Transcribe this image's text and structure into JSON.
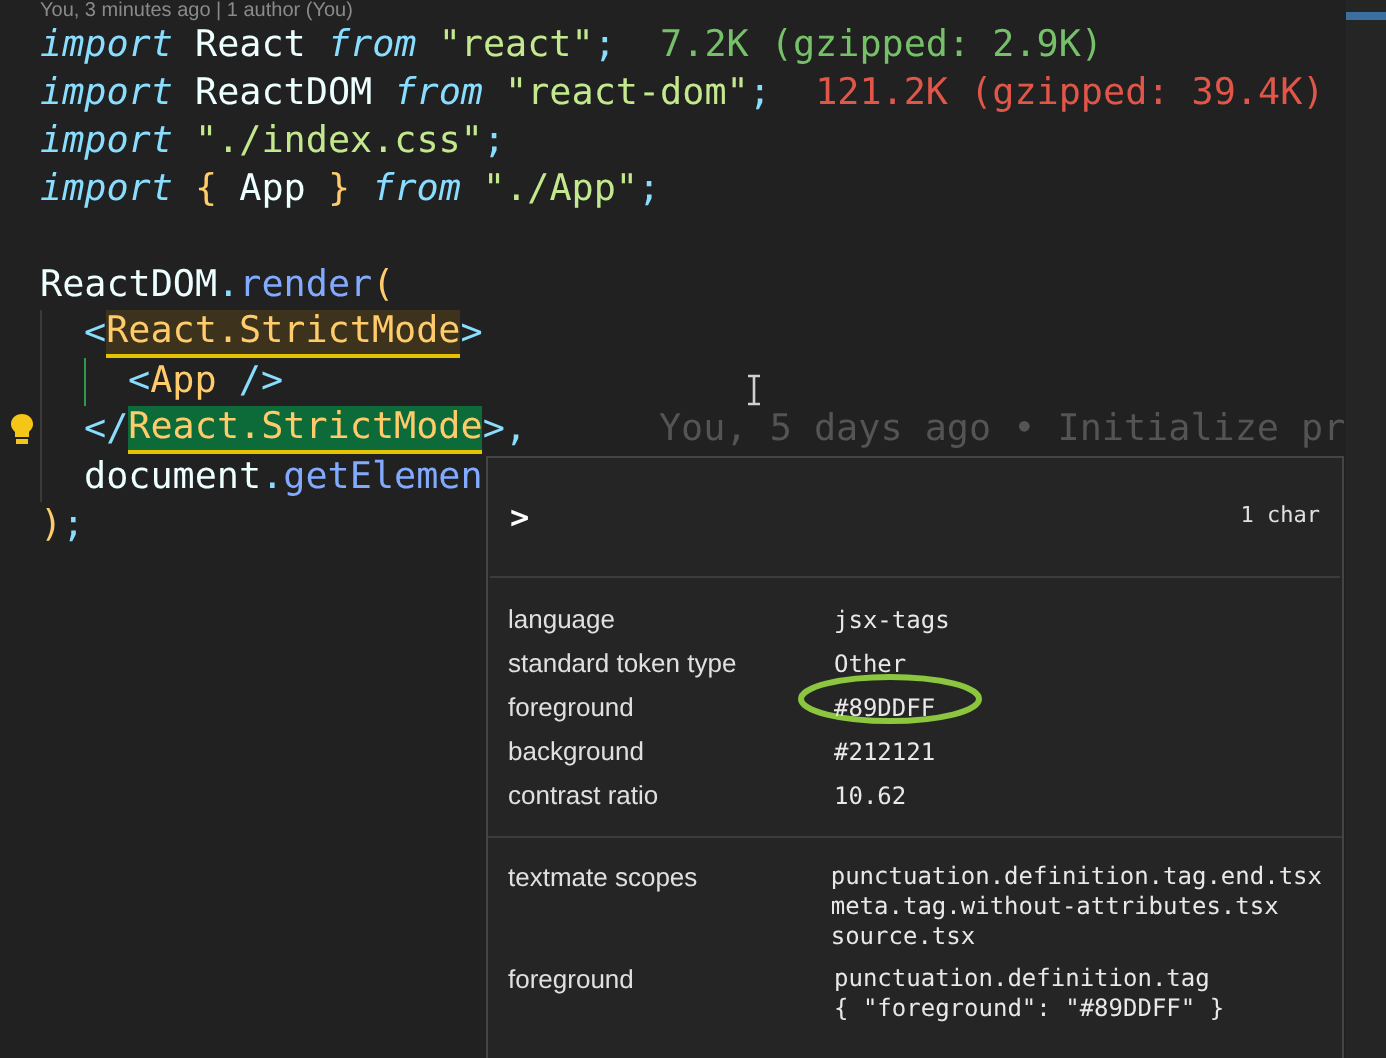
{
  "blame_header": "You, 3 minutes ago | 1 author (You)",
  "code_lines": [
    {
      "kind": "code",
      "tokens": [
        {
          "text": "import",
          "kind": "keyword"
        },
        {
          "text": " React ",
          "kind": "ident"
        },
        {
          "text": "from",
          "kind": "keyword"
        },
        {
          "text": " \"react\"",
          "kind": "string"
        },
        {
          "text": ";",
          "kind": "punct"
        },
        {
          "text": "  7.2K (gzipped: 2.9K)",
          "kind": "size-ok"
        }
      ]
    },
    {
      "kind": "code",
      "tokens": [
        {
          "text": "import",
          "kind": "keyword"
        },
        {
          "text": " ReactDOM ",
          "kind": "ident"
        },
        {
          "text": "from",
          "kind": "keyword"
        },
        {
          "text": " \"react-dom\"",
          "kind": "string"
        },
        {
          "text": ";",
          "kind": "punct"
        },
        {
          "text": "  121.2K (gzipped: 39.4K)",
          "kind": "size-bad"
        }
      ]
    },
    {
      "kind": "code",
      "tokens": [
        {
          "text": "import",
          "kind": "keyword"
        },
        {
          "text": " \"./index.css\"",
          "kind": "string"
        },
        {
          "text": ";",
          "kind": "punct"
        }
      ]
    },
    {
      "kind": "code",
      "tokens": [
        {
          "text": "import",
          "kind": "keyword"
        },
        {
          "text": " {",
          "kind": "brace"
        },
        {
          "text": " App ",
          "kind": "ident"
        },
        {
          "text": "}",
          "kind": "brace"
        },
        {
          "text": " from",
          "kind": "keyword"
        },
        {
          "text": " \"./App\"",
          "kind": "string"
        },
        {
          "text": ";",
          "kind": "punct"
        }
      ]
    },
    {
      "kind": "blank"
    },
    {
      "kind": "code",
      "tokens": [
        {
          "text": "ReactDOM",
          "kind": "ident"
        },
        {
          "text": ".",
          "kind": "punct"
        },
        {
          "text": "render",
          "kind": "method"
        },
        {
          "text": "(",
          "kind": "brace"
        }
      ]
    },
    {
      "kind": "code",
      "guides": [
        {
          "kind": "plain"
        }
      ],
      "tokens": [
        {
          "text": "<",
          "kind": "punct"
        },
        {
          "text": "React.StrictMode",
          "kind": "tag-bracket"
        },
        {
          "text": ">",
          "kind": "punct"
        }
      ]
    },
    {
      "kind": "code",
      "guides": [
        {
          "kind": "plain"
        },
        {
          "kind": "active"
        }
      ],
      "tokens": [
        {
          "text": "<",
          "kind": "punct"
        },
        {
          "text": "App",
          "kind": "tag"
        },
        {
          "text": " />",
          "kind": "punct"
        }
      ]
    },
    {
      "kind": "code",
      "guides": [
        {
          "kind": "plain"
        }
      ],
      "lightbulb": true,
      "annotation": "You, 5 days ago • Initialize pr",
      "tokens": [
        {
          "text": "</",
          "kind": "punct"
        },
        {
          "text": "React.StrictMode",
          "kind": "tag-match"
        },
        {
          "text": ">",
          "kind": "punct"
        },
        {
          "text": ",",
          "kind": "punct"
        }
      ]
    },
    {
      "kind": "code",
      "guides": [
        {
          "kind": "plain"
        }
      ],
      "tokens": [
        {
          "text": "document",
          "kind": "ident"
        },
        {
          "text": ".",
          "kind": "punct"
        },
        {
          "text": "getElemen",
          "kind": "method"
        }
      ]
    },
    {
      "kind": "code",
      "tokens": [
        {
          "text": ")",
          "kind": "brace"
        },
        {
          "text": ";",
          "kind": "punct"
        }
      ]
    }
  ],
  "hover_panel": {
    "chevron": ">",
    "char_count": "1 char",
    "rows": [
      {
        "label": "language",
        "value": "jsx-tags",
        "circled": false
      },
      {
        "label": "standard token type",
        "value": "Other",
        "circled": false
      },
      {
        "label": "foreground",
        "value": "#89DDFF",
        "circled": true
      },
      {
        "label": "background",
        "value": "#212121",
        "circled": false
      },
      {
        "label": "contrast ratio",
        "value": "10.62",
        "circled": false
      }
    ],
    "scope_rows": [
      {
        "label": "textmate scopes",
        "values": [
          "punctuation.definition.tag.end.tsx",
          "meta.tag.without-attributes.tsx",
          "source.tsx"
        ]
      },
      {
        "label": "foreground",
        "values": [
          "punctuation.definition.tag",
          "{ \"foreground\": \"#89DDFF\" }"
        ]
      }
    ]
  }
}
